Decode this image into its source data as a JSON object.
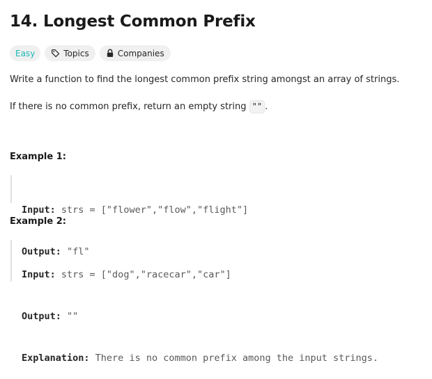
{
  "problem": {
    "title": "14. Longest Common Prefix",
    "difficulty": "Easy",
    "tags": {
      "topics": "Topics",
      "companies": "Companies"
    },
    "description": {
      "line1": "Write a function to find the longest common prefix string amongst an array of strings.",
      "line2_prefix": "If there is no common prefix, return an empty string ",
      "line2_code": "\"\"",
      "line2_suffix": "."
    },
    "examples": [
      {
        "heading": "Example 1:",
        "input_label": "Input:",
        "input_value": " strs = [\"flower\",\"flow\",\"flight\"]",
        "output_label": "Output:",
        "output_value": " \"fl\""
      },
      {
        "heading": "Example 2:",
        "input_label": "Input:",
        "input_value": " strs = [\"dog\",\"racecar\",\"car\"]",
        "output_label": "Output:",
        "output_value": " \"\"",
        "explanation_label": "Explanation:",
        "explanation_value": " There is no common prefix among the input strings."
      }
    ]
  },
  "colors": {
    "easy": "#1cb8b8",
    "tag_background": "#f0f0f0",
    "text": "#262626"
  },
  "icons": {
    "topics": "tag-icon",
    "companies": "lock-icon"
  }
}
